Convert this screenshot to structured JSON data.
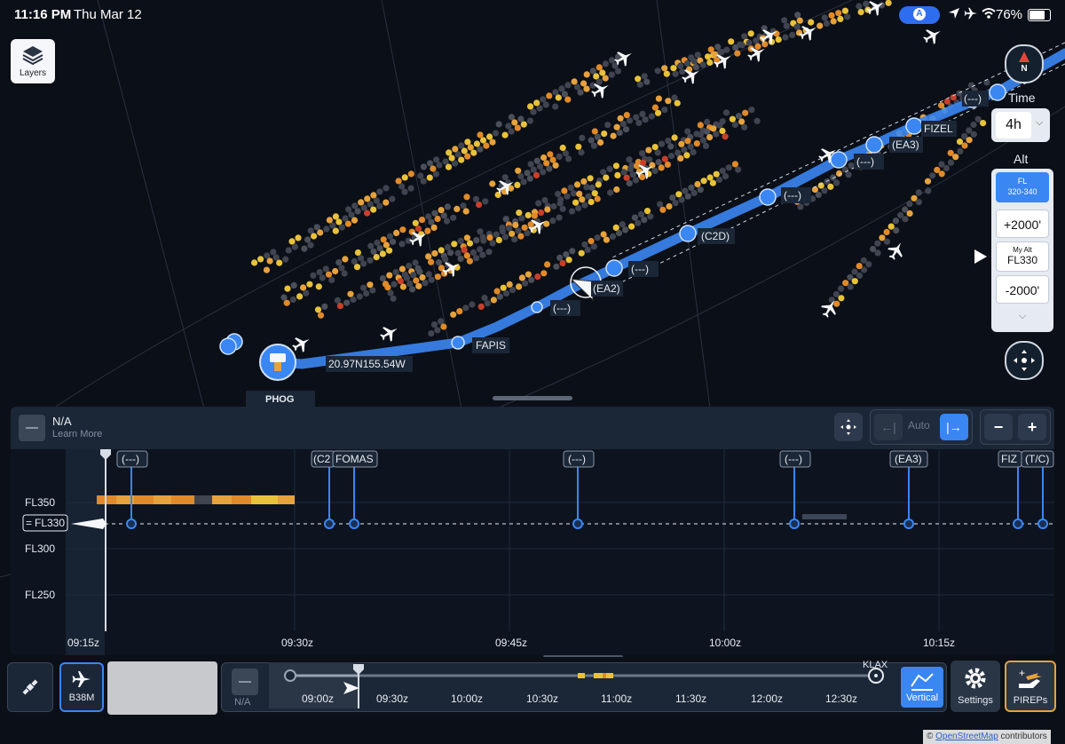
{
  "status_bar": {
    "time": "11:16 PM",
    "date": "Thu Mar 12",
    "battery": "76%",
    "location_badge": "A"
  },
  "map": {
    "layers_label": "Layers",
    "compass_label": "N",
    "airport_label": "PHOG",
    "coord_label": "20.97N155.54W",
    "waypoint_labels": [
      "FAPIS",
      "(---)",
      "(EA2)",
      "(---)",
      "(C2D)",
      "(---)",
      "(---)",
      "(EA3)",
      "FIZEL",
      "(---)"
    ]
  },
  "time_control": {
    "label": "Time",
    "value": "4h"
  },
  "alt_control": {
    "label": "Alt",
    "fl_title": "FL",
    "fl_range": "320-340",
    "plus_label": "+2000'",
    "my_alt_title": "My Alt",
    "my_alt_value": "FL330",
    "minus_label": "-2000'"
  },
  "profile": {
    "title": "N/A",
    "subtitle": "Learn More",
    "auto_label": "Auto",
    "flight_levels": [
      "FL350",
      "FL300",
      "FL250"
    ],
    "current_fl": "FL330",
    "current_fl_prefix": "=",
    "time_ticks": [
      "09:15z",
      "09:30z",
      "09:45z",
      "10:00z",
      "10:15z"
    ],
    "waypoints": [
      "(---)",
      "(C2",
      "FOMAS",
      "(---)",
      "(---)",
      "(EA3)",
      "FIZ",
      "(T/C)"
    ]
  },
  "bottom_bar": {
    "aircraft_type": "B38M",
    "na_label": "N/A",
    "destination": "KLAX",
    "timeline_ticks": [
      "09:00z",
      "09:30z",
      "10:00z",
      "10:30z",
      "11:00z",
      "11:30z",
      "12:00z",
      "12:30z"
    ],
    "vertical_label": "Vertical",
    "settings_label": "Settings",
    "pireps_label": "PIREPs"
  },
  "attribution": {
    "prefix": "©",
    "link": "OpenStreetMap",
    "suffix": "contributors"
  },
  "colors": {
    "route": "#3a86f2",
    "turbulence_light": "#e8c23a",
    "turbulence_moderate": "#e08a2a",
    "turbulence_severe": "#c8402a",
    "smooth": "#3f4450",
    "accent": "#3a86f2",
    "pirep_border": "#e6a23c"
  }
}
